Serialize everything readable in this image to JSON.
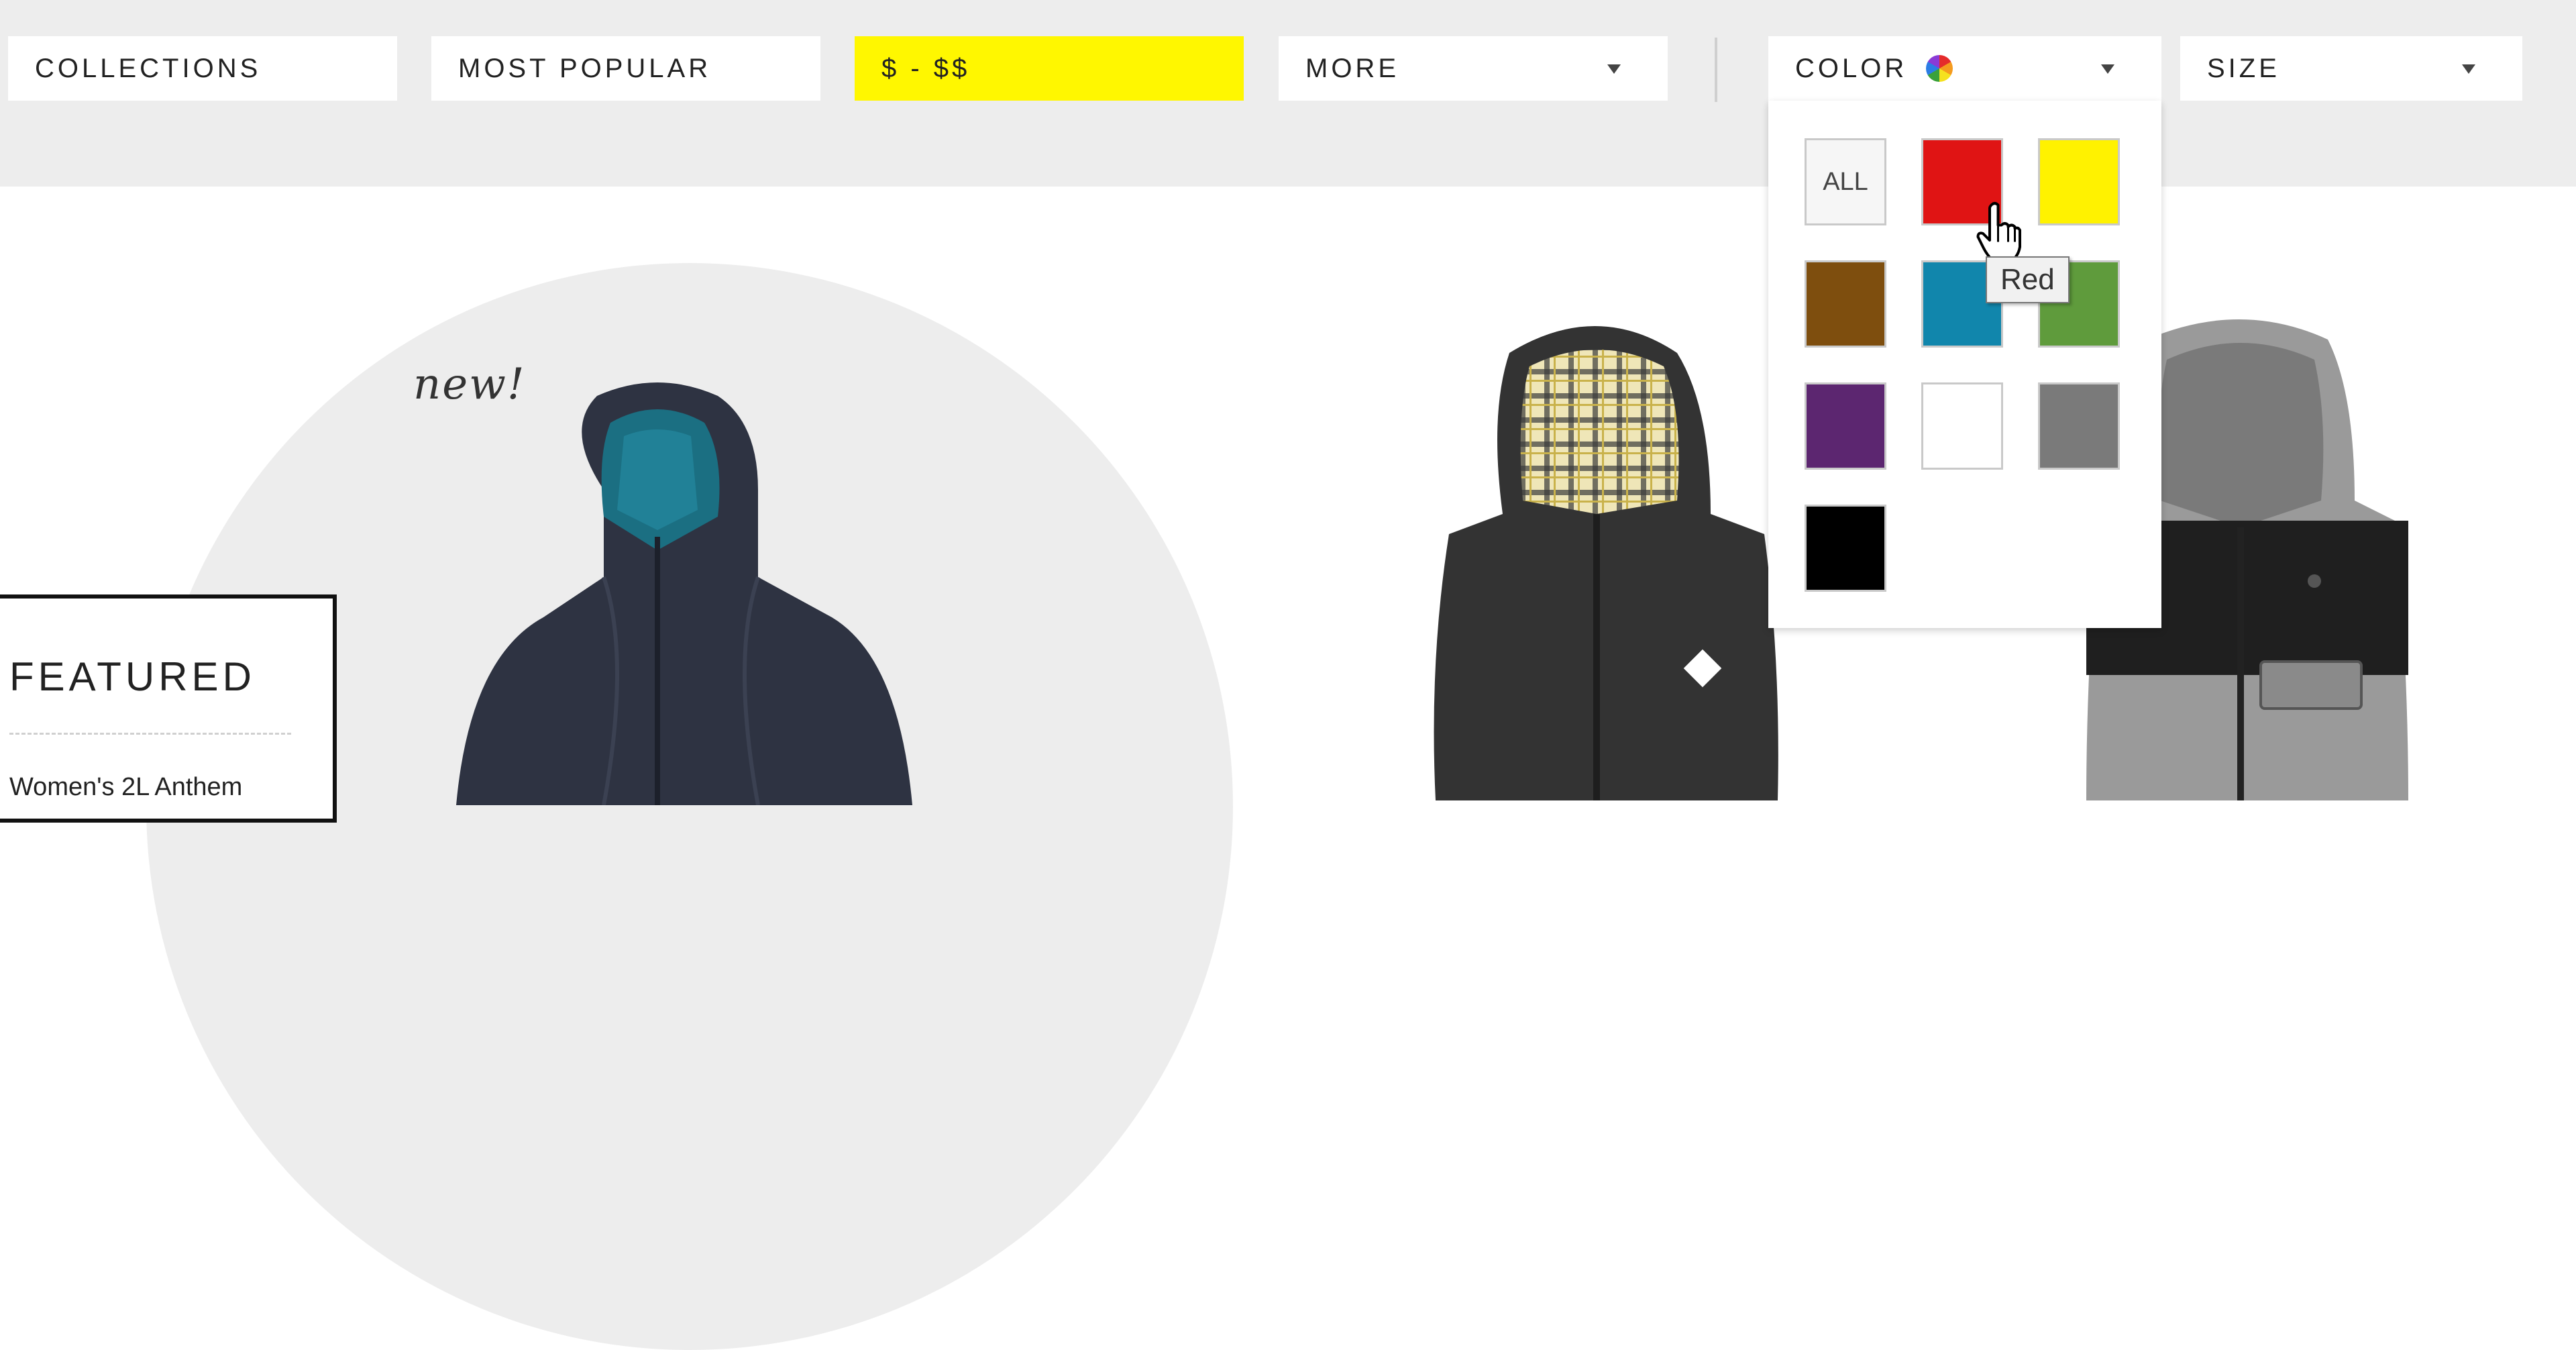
{
  "filters": {
    "collections": "COLLECTIONS",
    "most_popular": "MOST POPULAR",
    "price": "$ - $$",
    "more": "MORE",
    "color": "COLOR",
    "size": "SIZE"
  },
  "active_filter_color": "#fff700",
  "color_dropdown": {
    "all_label": "ALL",
    "swatches": [
      {
        "name": "red",
        "hex": "#e01414"
      },
      {
        "name": "yellow",
        "hex": "#fff200"
      },
      {
        "name": "brown",
        "hex": "#7e4e0e"
      },
      {
        "name": "teal",
        "hex": "#1186ac"
      },
      {
        "name": "green",
        "hex": "#5f9b3c"
      },
      {
        "name": "purple",
        "hex": "#5c2670"
      },
      {
        "name": "white",
        "hex": "#ffffff"
      },
      {
        "name": "gray",
        "hex": "#7a7a7a"
      },
      {
        "name": "black",
        "hex": "#000000"
      }
    ],
    "tooltip": "Red"
  },
  "hero": {
    "new_tag": "new!"
  },
  "featured": {
    "title": "FEATURED",
    "item": "Women's 2L Anthem"
  },
  "icons": {
    "color_indicator": "color-wheel-icon",
    "caret": "chevron-down-icon",
    "cursor": "hand-pointer-icon"
  }
}
